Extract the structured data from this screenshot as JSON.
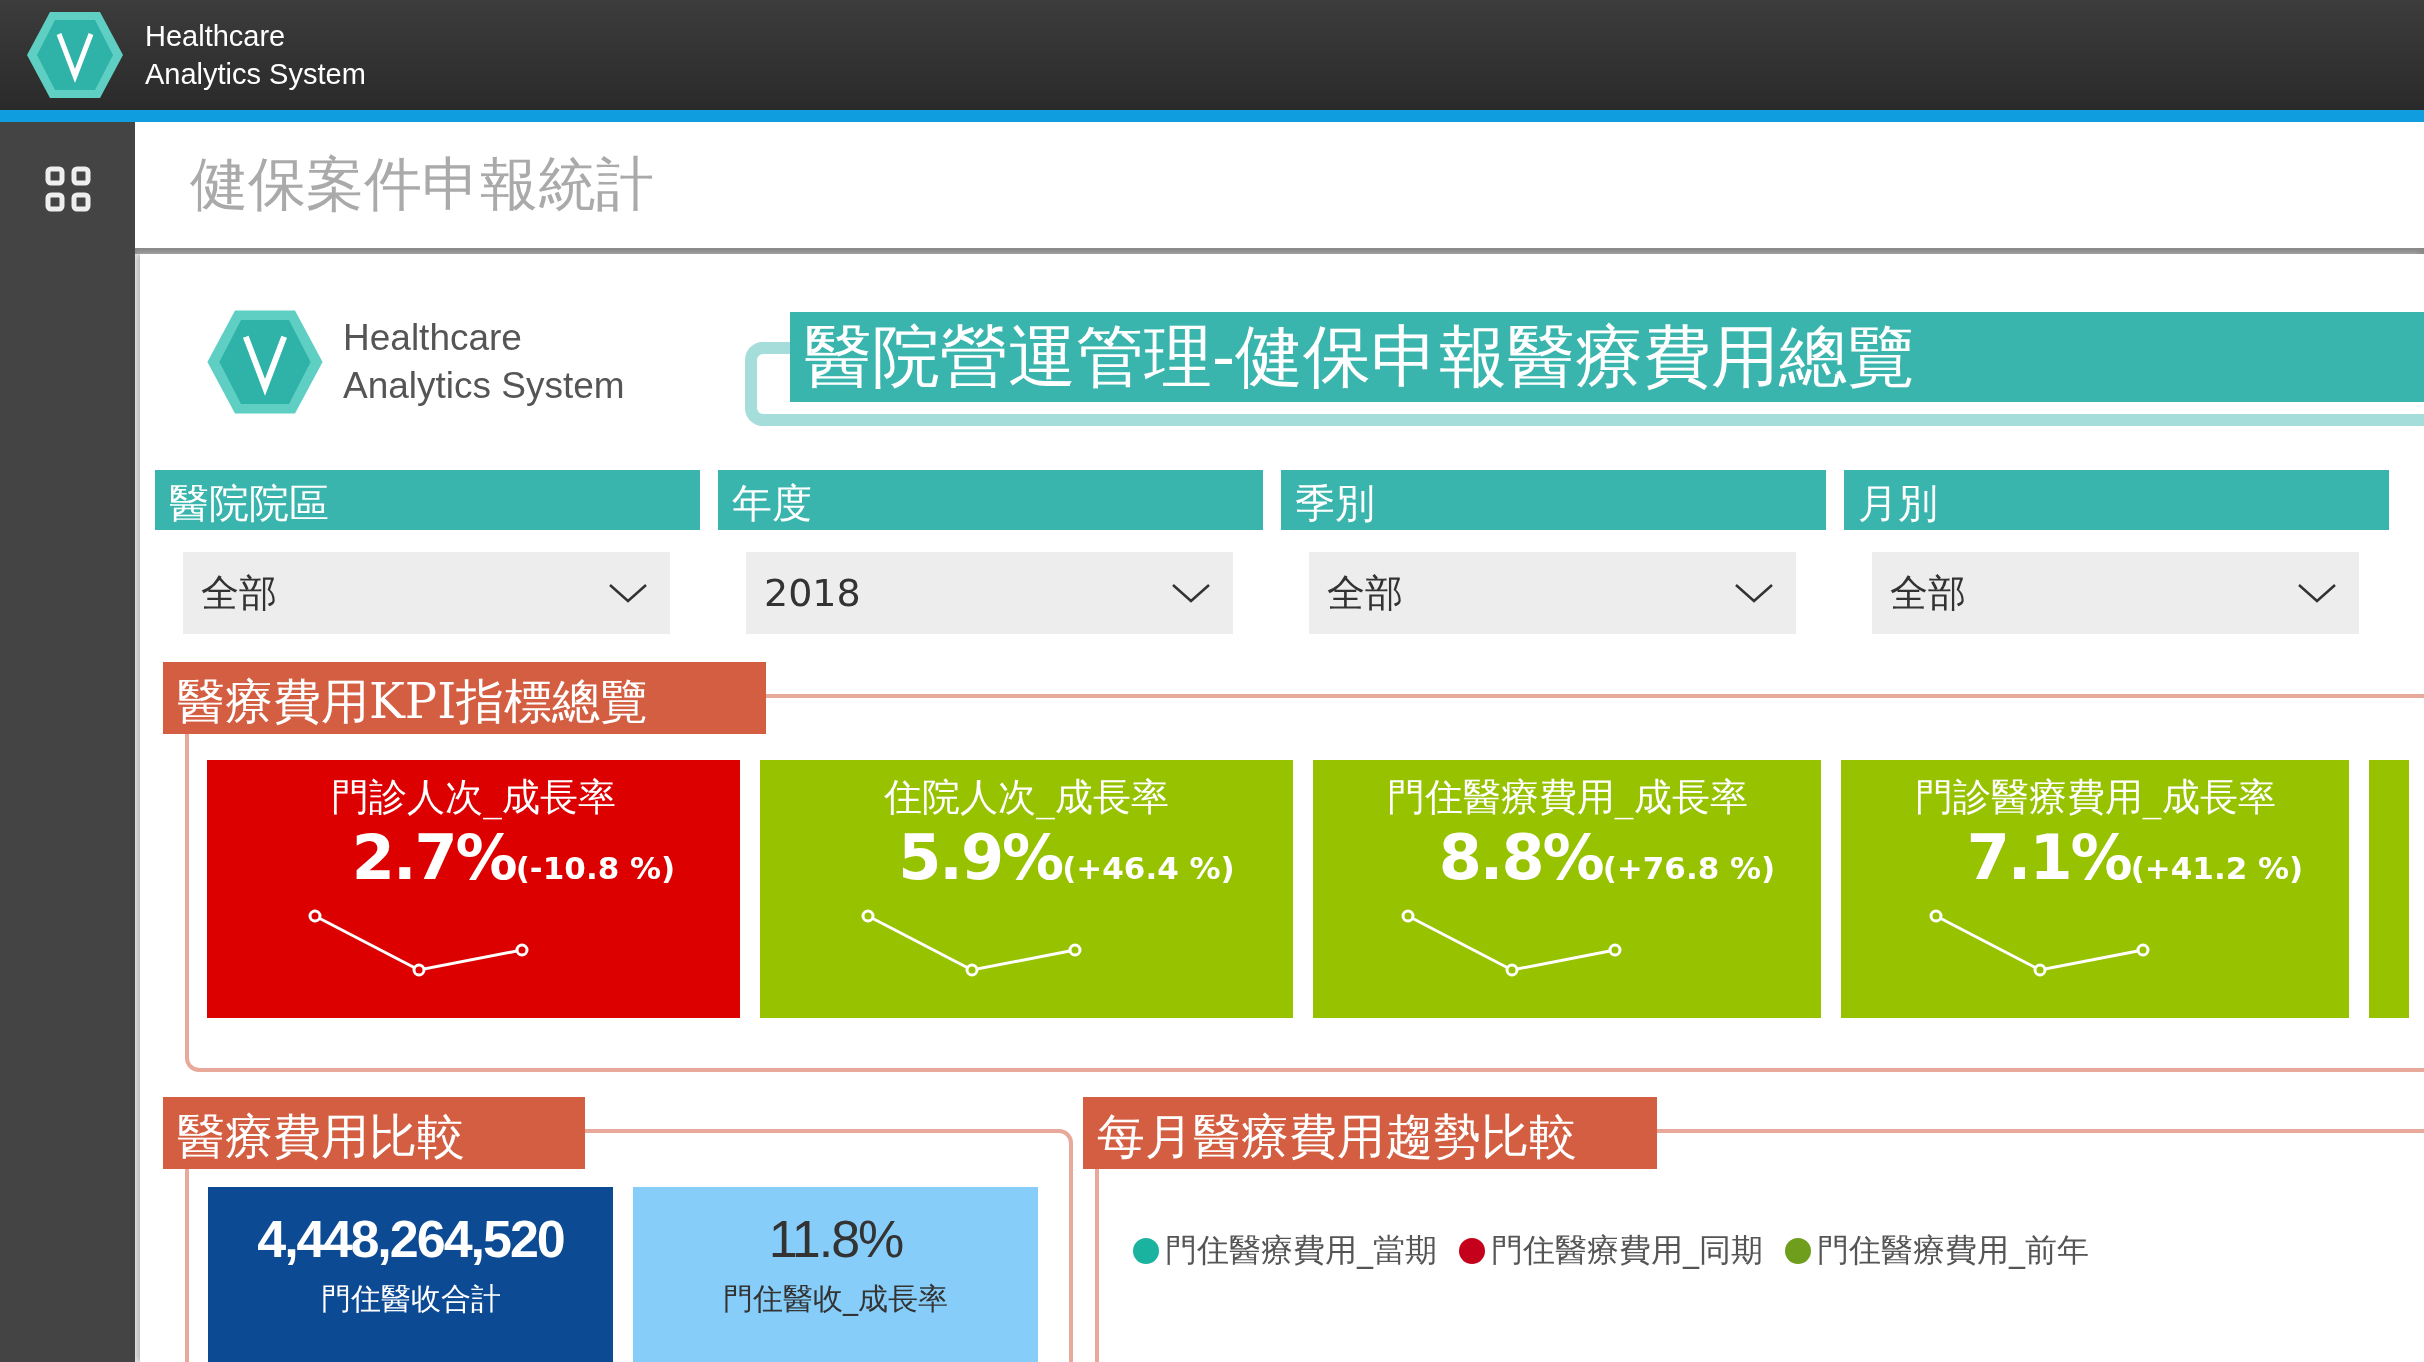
{
  "app_bar": {
    "brand_lines": [
      "Healthcare",
      "Analytics System"
    ]
  },
  "page": {
    "title": "健保案件申報統計"
  },
  "report": {
    "logo_lines": [
      "Healthcare",
      "Analytics System"
    ],
    "title": "醫院營運管理-健保申報醫療費用總覽"
  },
  "filters": [
    {
      "label": "醫院院區",
      "value": "全部"
    },
    {
      "label": "年度",
      "value": "2018"
    },
    {
      "label": "季別",
      "value": "全部"
    },
    {
      "label": "月別",
      "value": "全部"
    }
  ],
  "kpi_section": {
    "title": "醫療費用KPI指標總覽",
    "cards": [
      {
        "title": "門診人次_成長率",
        "value": "2.7%",
        "change": "(-10.8 %)",
        "color": "#dd0000"
      },
      {
        "title": "住院人次_成長率",
        "value": "5.9%",
        "change": "(+46.4 %)",
        "color": "#97c200"
      },
      {
        "title": "門住醫療費用_成長率",
        "value": "8.8%",
        "change": "(+76.8 %)",
        "color": "#97c200"
      },
      {
        "title": "門診醫療費用_成長率",
        "value": "7.1%",
        "change": "(+41.2 %)",
        "color": "#97c200"
      }
    ]
  },
  "compare_section": {
    "title": "醫療費用比較",
    "cards": [
      {
        "value": "4,448,264,520",
        "label": "門住醫收合計",
        "color": "#0d4a94"
      },
      {
        "value": "11.8%",
        "label": "門住醫收_成長率",
        "color": "#87cdf9"
      }
    ]
  },
  "trend_section": {
    "title": "每月醫療費用趨勢比較",
    "legend": [
      {
        "label": "門住醫療費用_當期",
        "color": "#1ab3a0"
      },
      {
        "label": "門住醫療費用_同期",
        "color": "#c4001a"
      },
      {
        "label": "門住醫療費用_前年",
        "color": "#6e9e1c"
      }
    ]
  }
}
